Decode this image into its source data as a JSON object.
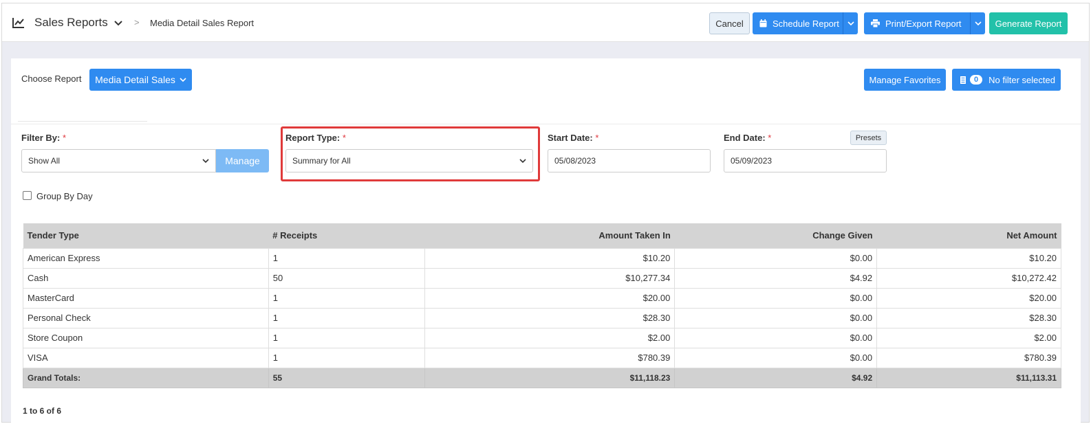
{
  "header": {
    "title": "Sales Reports",
    "breadcrumb_sep": ">",
    "breadcrumb": "Media Detail Sales Report",
    "cancel": "Cancel",
    "schedule": "Schedule Report",
    "print_export": "Print/Export Report",
    "generate": "Generate Report"
  },
  "controls": {
    "choose_report_label": "Choose Report",
    "report_dropdown": "Media Detail Sales",
    "manage_favorites": "Manage Favorites",
    "filter_count": "0",
    "filter_label": "No filter selected"
  },
  "filters": {
    "filter_by_label": "Filter By:",
    "filter_by_value": "Show All",
    "manage": "Manage",
    "report_type_label": "Report Type:",
    "report_type_value": "Summary for All",
    "start_date_label": "Start Date:",
    "start_date": "05/08/2023",
    "end_date_label": "End Date:",
    "end_date": "05/09/2023",
    "presets": "Presets",
    "required_mark": "*",
    "group_by_day": "Group By Day"
  },
  "table": {
    "columns": [
      "Tender Type",
      "# Receipts",
      "Amount Taken In",
      "Change Given",
      "Net Amount"
    ],
    "rows": [
      [
        "American Express",
        "1",
        "$10.20",
        "$0.00",
        "$10.20"
      ],
      [
        "Cash",
        "50",
        "$10,277.34",
        "$4.92",
        "$10,272.42"
      ],
      [
        "MasterCard",
        "1",
        "$20.00",
        "$0.00",
        "$20.00"
      ],
      [
        "Personal Check",
        "1",
        "$28.30",
        "$0.00",
        "$28.30"
      ],
      [
        "Store Coupon",
        "1",
        "$2.00",
        "$0.00",
        "$2.00"
      ],
      [
        "VISA",
        "1",
        "$780.39",
        "$0.00",
        "$780.39"
      ]
    ],
    "totals": [
      "Grand Totals:",
      "55",
      "$11,118.23",
      "$4.92",
      "$11,113.31"
    ]
  },
  "pager": "1 to 6 of 6"
}
